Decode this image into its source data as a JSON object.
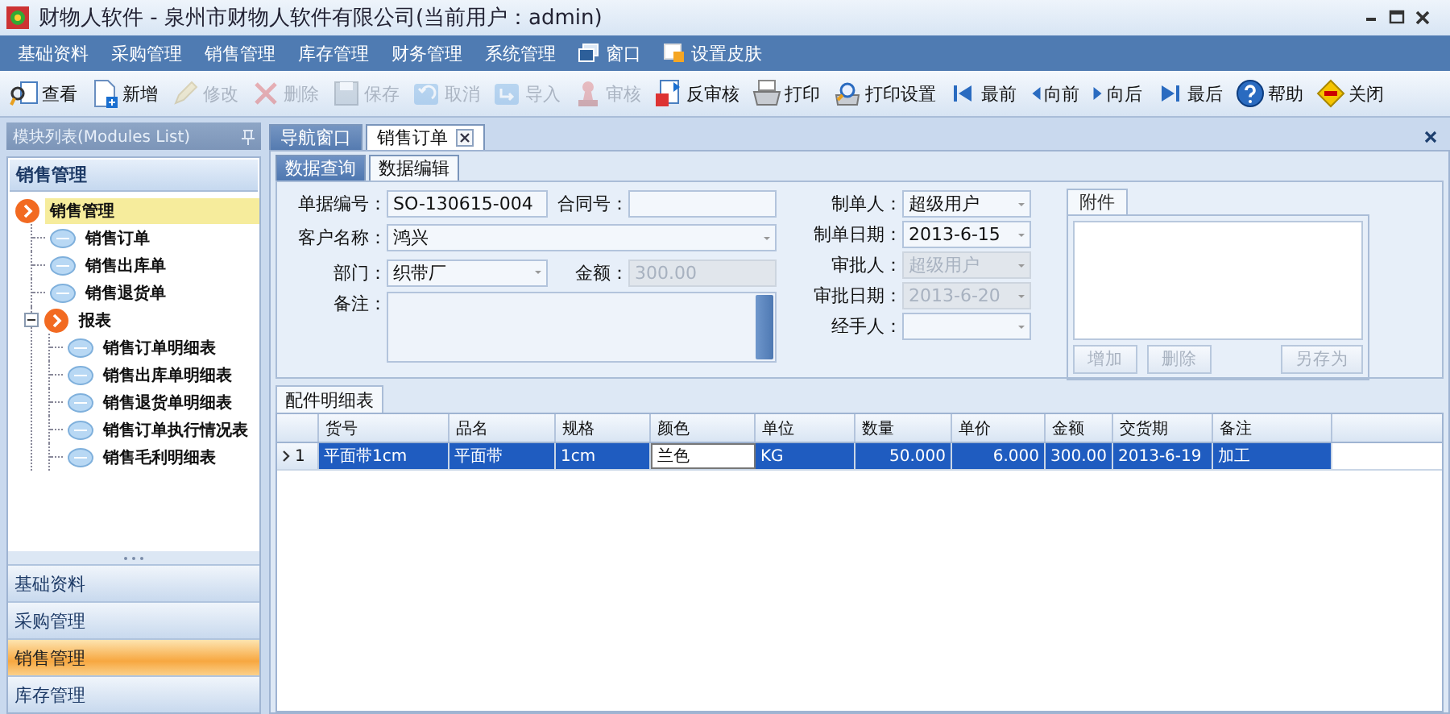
{
  "window": {
    "title": "财物人软件 - 泉州市财物人软件有限公司(当前用户：admin)"
  },
  "menu": [
    {
      "label": "基础资料",
      "kind": "text"
    },
    {
      "label": "采购管理",
      "kind": "text"
    },
    {
      "label": "销售管理",
      "kind": "text"
    },
    {
      "label": "库存管理",
      "kind": "text"
    },
    {
      "label": "财务管理",
      "kind": "text"
    },
    {
      "label": "系统管理",
      "kind": "text"
    },
    {
      "label": "窗口",
      "kind": "window"
    },
    {
      "label": "设置皮肤",
      "kind": "skin"
    }
  ],
  "toolbar": [
    {
      "label": "查看",
      "kind": "view",
      "disabled": false
    },
    {
      "label": "新增",
      "kind": "new",
      "disabled": false
    },
    {
      "label": "修改",
      "kind": "edit",
      "disabled": true
    },
    {
      "label": "删除",
      "kind": "delete",
      "disabled": true
    },
    {
      "label": "保存",
      "kind": "save",
      "disabled": true
    },
    {
      "label": "取消",
      "kind": "cancel",
      "disabled": true
    },
    {
      "label": "导入",
      "kind": "import",
      "disabled": true
    },
    {
      "label": "审核",
      "kind": "audit",
      "disabled": true
    },
    {
      "label": "反审核",
      "kind": "unaudit",
      "disabled": false
    },
    {
      "label": "打印",
      "kind": "print",
      "disabled": false
    },
    {
      "label": "打印设置",
      "kind": "printsetup",
      "disabled": false
    },
    {
      "label": "最前",
      "kind": "first",
      "disabled": false
    },
    {
      "label": "向前",
      "kind": "prev",
      "disabled": false
    },
    {
      "label": "向后",
      "kind": "next",
      "disabled": false
    },
    {
      "label": "最后",
      "kind": "last",
      "disabled": false
    },
    {
      "label": "帮助",
      "kind": "help",
      "disabled": false
    },
    {
      "label": "关闭",
      "kind": "exit",
      "disabled": false
    }
  ],
  "sidebar": {
    "title": "模块列表(Modules List)",
    "group": "销售管理",
    "tree": [
      {
        "label": "销售管理",
        "kind": "folder",
        "selected": true,
        "children": [
          {
            "label": "销售订单",
            "kind": "leaf",
            "selected": false
          },
          {
            "label": "销售出库单",
            "kind": "leaf",
            "selected": false
          },
          {
            "label": "销售退货单",
            "kind": "leaf",
            "selected": false
          },
          {
            "label": "报表",
            "kind": "folder",
            "selected": false,
            "expanded": true,
            "children": [
              {
                "label": "销售订单明细表",
                "kind": "leaf",
                "selected": false
              },
              {
                "label": "销售出库单明细表",
                "kind": "leaf",
                "selected": false
              },
              {
                "label": "销售退货单明细表",
                "kind": "leaf",
                "selected": false
              },
              {
                "label": "销售订单执行情况表",
                "kind": "leaf",
                "selected": false
              },
              {
                "label": "销售毛利明细表",
                "kind": "leaf",
                "selected": false
              }
            ]
          }
        ]
      }
    ],
    "nav": [
      {
        "label": "基础资料",
        "selected": false
      },
      {
        "label": "采购管理",
        "selected": false
      },
      {
        "label": "销售管理",
        "selected": true
      },
      {
        "label": "库存管理",
        "selected": false
      }
    ]
  },
  "tabs": [
    {
      "label": "导航窗口",
      "selected": false,
      "closable": false
    },
    {
      "label": "销售订单",
      "selected": true,
      "closable": true
    }
  ],
  "subtabs": [
    {
      "label": "数据查询",
      "selected": false
    },
    {
      "label": "数据编辑",
      "selected": true
    }
  ],
  "form": {
    "rows": [
      [
        {
          "label": "单据编号：",
          "kind": "text",
          "value": "SO-130615-004",
          "disabled": false
        },
        {
          "label": "合同号：",
          "kind": "text",
          "disabled": false
        }
      ],
      [
        {
          "label": "客户名称：",
          "kind": "combo",
          "value": "鸿兴",
          "disabled": false
        }
      ],
      [
        {
          "label": "部门：",
          "kind": "combo",
          "value": "织带厂",
          "disabled": false
        },
        {
          "label": "金额：",
          "kind": "text",
          "value": "300.00",
          "disabled": true
        }
      ],
      [
        {
          "label": "备注：",
          "kind": "memo",
          "disabled": false
        }
      ]
    ],
    "side": [
      {
        "label": "制单人：",
        "kind": "combo",
        "value": "超级用户",
        "disabled": false
      },
      {
        "label": "制单日期：",
        "kind": "combo",
        "value": "2013-6-15",
        "disabled": false
      },
      {
        "label": "审批人：",
        "kind": "combo",
        "value": "超级用户",
        "disabled": true
      },
      {
        "label": "审批日期：",
        "kind": "combo",
        "value": "2013-6-20",
        "disabled": true
      },
      {
        "label": "经手人：",
        "kind": "combo",
        "disabled": false
      }
    ],
    "attachment": {
      "tab": "附件",
      "buttons": [
        {
          "label": "增加",
          "disabled": true
        },
        {
          "label": "删除",
          "disabled": true
        },
        {
          "label": "另存为",
          "disabled": true
        }
      ]
    }
  },
  "grid": {
    "tab": "配件明细表",
    "columns": [
      {
        "label": "货号",
        "kind": "text"
      },
      {
        "label": "品名",
        "kind": "text"
      },
      {
        "label": "规格",
        "kind": "text"
      },
      {
        "label": "颜色",
        "kind": "text"
      },
      {
        "label": "单位",
        "kind": "text"
      },
      {
        "label": "数量",
        "kind": "number"
      },
      {
        "label": "单价",
        "kind": "number"
      },
      {
        "label": "金额",
        "kind": "number"
      },
      {
        "label": "交货期",
        "kind": "text"
      },
      {
        "label": "备注",
        "kind": "text"
      }
    ],
    "rows": [
      {
        "number": "1",
        "selected": true,
        "cells": [
          {
            "text": "平面带1cm",
            "editing": false
          },
          {
            "text": "平面带",
            "editing": false
          },
          {
            "text": "1cm",
            "editing": false
          },
          {
            "text": "兰色",
            "editing": true
          },
          {
            "text": "KG",
            "editing": false
          },
          {
            "text": "50.000",
            "editing": false
          },
          {
            "text": "6.000",
            "editing": false
          },
          {
            "text": "300.00",
            "editing": false
          },
          {
            "text": "2013-6-19",
            "editing": false
          },
          {
            "text": "加工",
            "editing": false
          }
        ]
      }
    ]
  }
}
